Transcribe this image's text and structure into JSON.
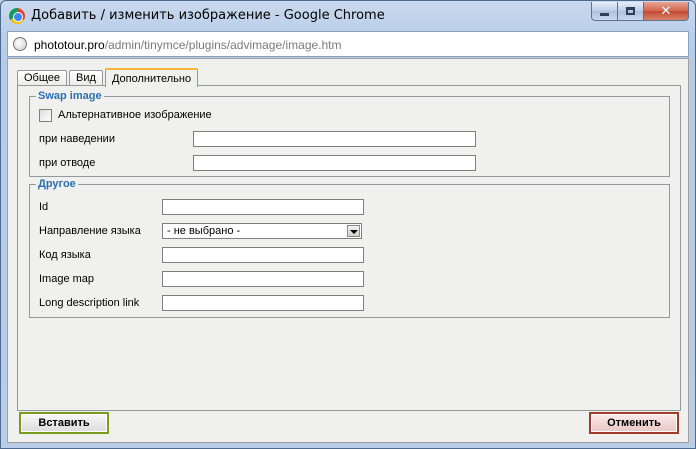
{
  "window": {
    "title": "Добавить / изменить изображение - Google Chrome"
  },
  "address": {
    "host": "phototour.pro",
    "path": "/admin/tinymce/plugins/advimage/image.htm"
  },
  "tabs": [
    {
      "label": "Общее"
    },
    {
      "label": "Вид"
    },
    {
      "label": "Дополнительно"
    }
  ],
  "swap": {
    "legend": "Swap image",
    "alt_checkbox_label": "Альтернативное изображение",
    "on_hover_label": "при наведении",
    "on_hover_value": "",
    "on_out_label": "при отводе",
    "on_out_value": ""
  },
  "other": {
    "legend": "Другое",
    "id_label": "Id",
    "id_value": "",
    "dir_label": "Направление языка",
    "dir_selected": "- не выбрано -",
    "lang_label": "Код языка",
    "lang_value": "",
    "map_label": "Image map",
    "map_value": "",
    "longdesc_label": "Long description link",
    "longdesc_value": ""
  },
  "buttons": {
    "insert": "Вставить",
    "cancel": "Отменить"
  }
}
